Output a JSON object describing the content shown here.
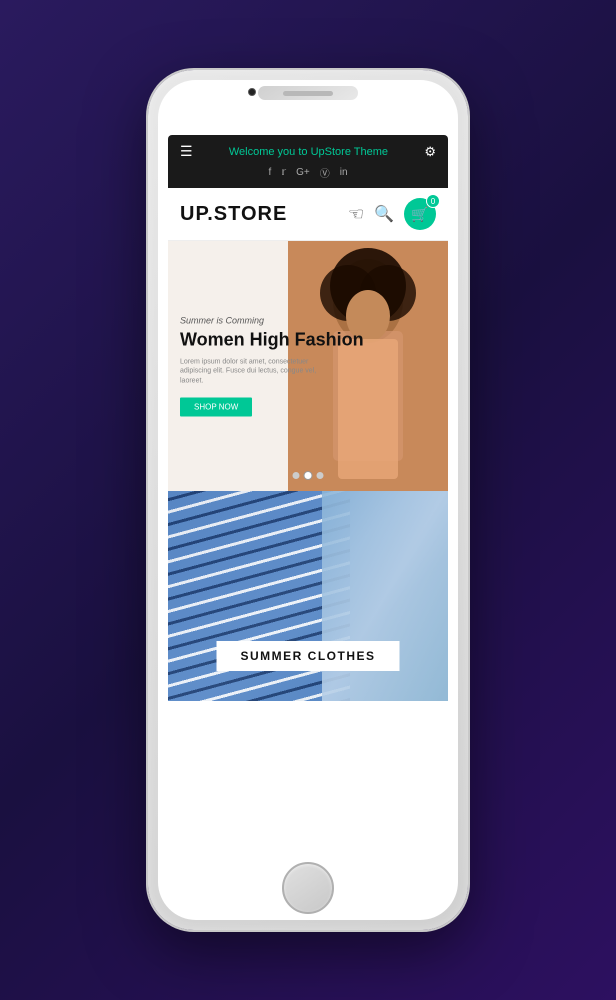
{
  "background": {
    "color": "#2a1a5e"
  },
  "phone": {
    "topbar": {
      "welcome_text": "Welcome you to ",
      "brand": "UpStore",
      "theme_text": " Theme",
      "social_icons": [
        "f",
        "t",
        "G+",
        "ig",
        "in"
      ]
    },
    "navbar": {
      "logo_up": "UP.",
      "logo_store": "STORE",
      "cart_count": "0"
    },
    "hero": {
      "subtitle": "Summer is Comming",
      "title": "Women High Fashion",
      "description": "Lorem ipsum dolor sit amet, consectetuer adipiscing elit. Fusce dui lectus, congue vel, laoreet.",
      "button_label": "SHOP NOW",
      "dot_count": 3,
      "active_dot": 1
    },
    "summer": {
      "label": "SUMMER CLOTHES"
    }
  }
}
